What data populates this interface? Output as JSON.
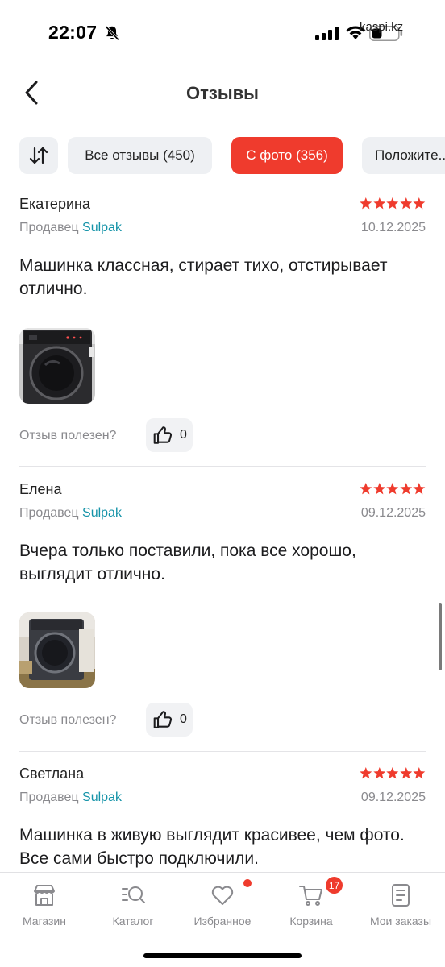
{
  "status_bar": {
    "time": "22:07",
    "url": "kaspi.kz"
  },
  "header": {
    "title": "Отзывы"
  },
  "filters": {
    "all_reviews": "Все отзывы (450)",
    "with_photo": "С фото (356)",
    "positive": "Положите..."
  },
  "reviews": [
    {
      "name": "Екатерина",
      "rating": 5,
      "seller_prefix": "Продавец",
      "seller": "Sulpak",
      "date": "10.12.2025",
      "text": "Машинка классная, стирает тихо, отстирывает отлично.",
      "helpful_label": "Отзыв полезен?",
      "likes": "0"
    },
    {
      "name": "Елена",
      "rating": 5,
      "seller_prefix": "Продавец",
      "seller": "Sulpak",
      "date": "09.12.2025",
      "text": "Вчера только поставили, пока все хорошо, выглядит отлично.",
      "helpful_label": "Отзыв полезен?",
      "likes": "0"
    },
    {
      "name": "Светлана",
      "rating": 5,
      "seller_prefix": "Продавец",
      "seller": "Sulpak",
      "date": "09.12.2025",
      "text": "Машинка в живую выглядит красивее, чем фото. Все сами быстро подключили."
    }
  ],
  "nav": {
    "items": [
      {
        "label": "Магазин",
        "icon": "shop-icon"
      },
      {
        "label": "Каталог",
        "icon": "catalog-search-icon"
      },
      {
        "label": "Избранное",
        "icon": "heart-icon"
      },
      {
        "label": "Корзина",
        "icon": "cart-icon"
      },
      {
        "label": "Мои заказы",
        "icon": "orders-icon"
      }
    ],
    "cart_badge": "17"
  },
  "colors": {
    "accent": "#ef3b2d",
    "seller_link": "#1493a8",
    "muted": "#8a8a8e"
  }
}
